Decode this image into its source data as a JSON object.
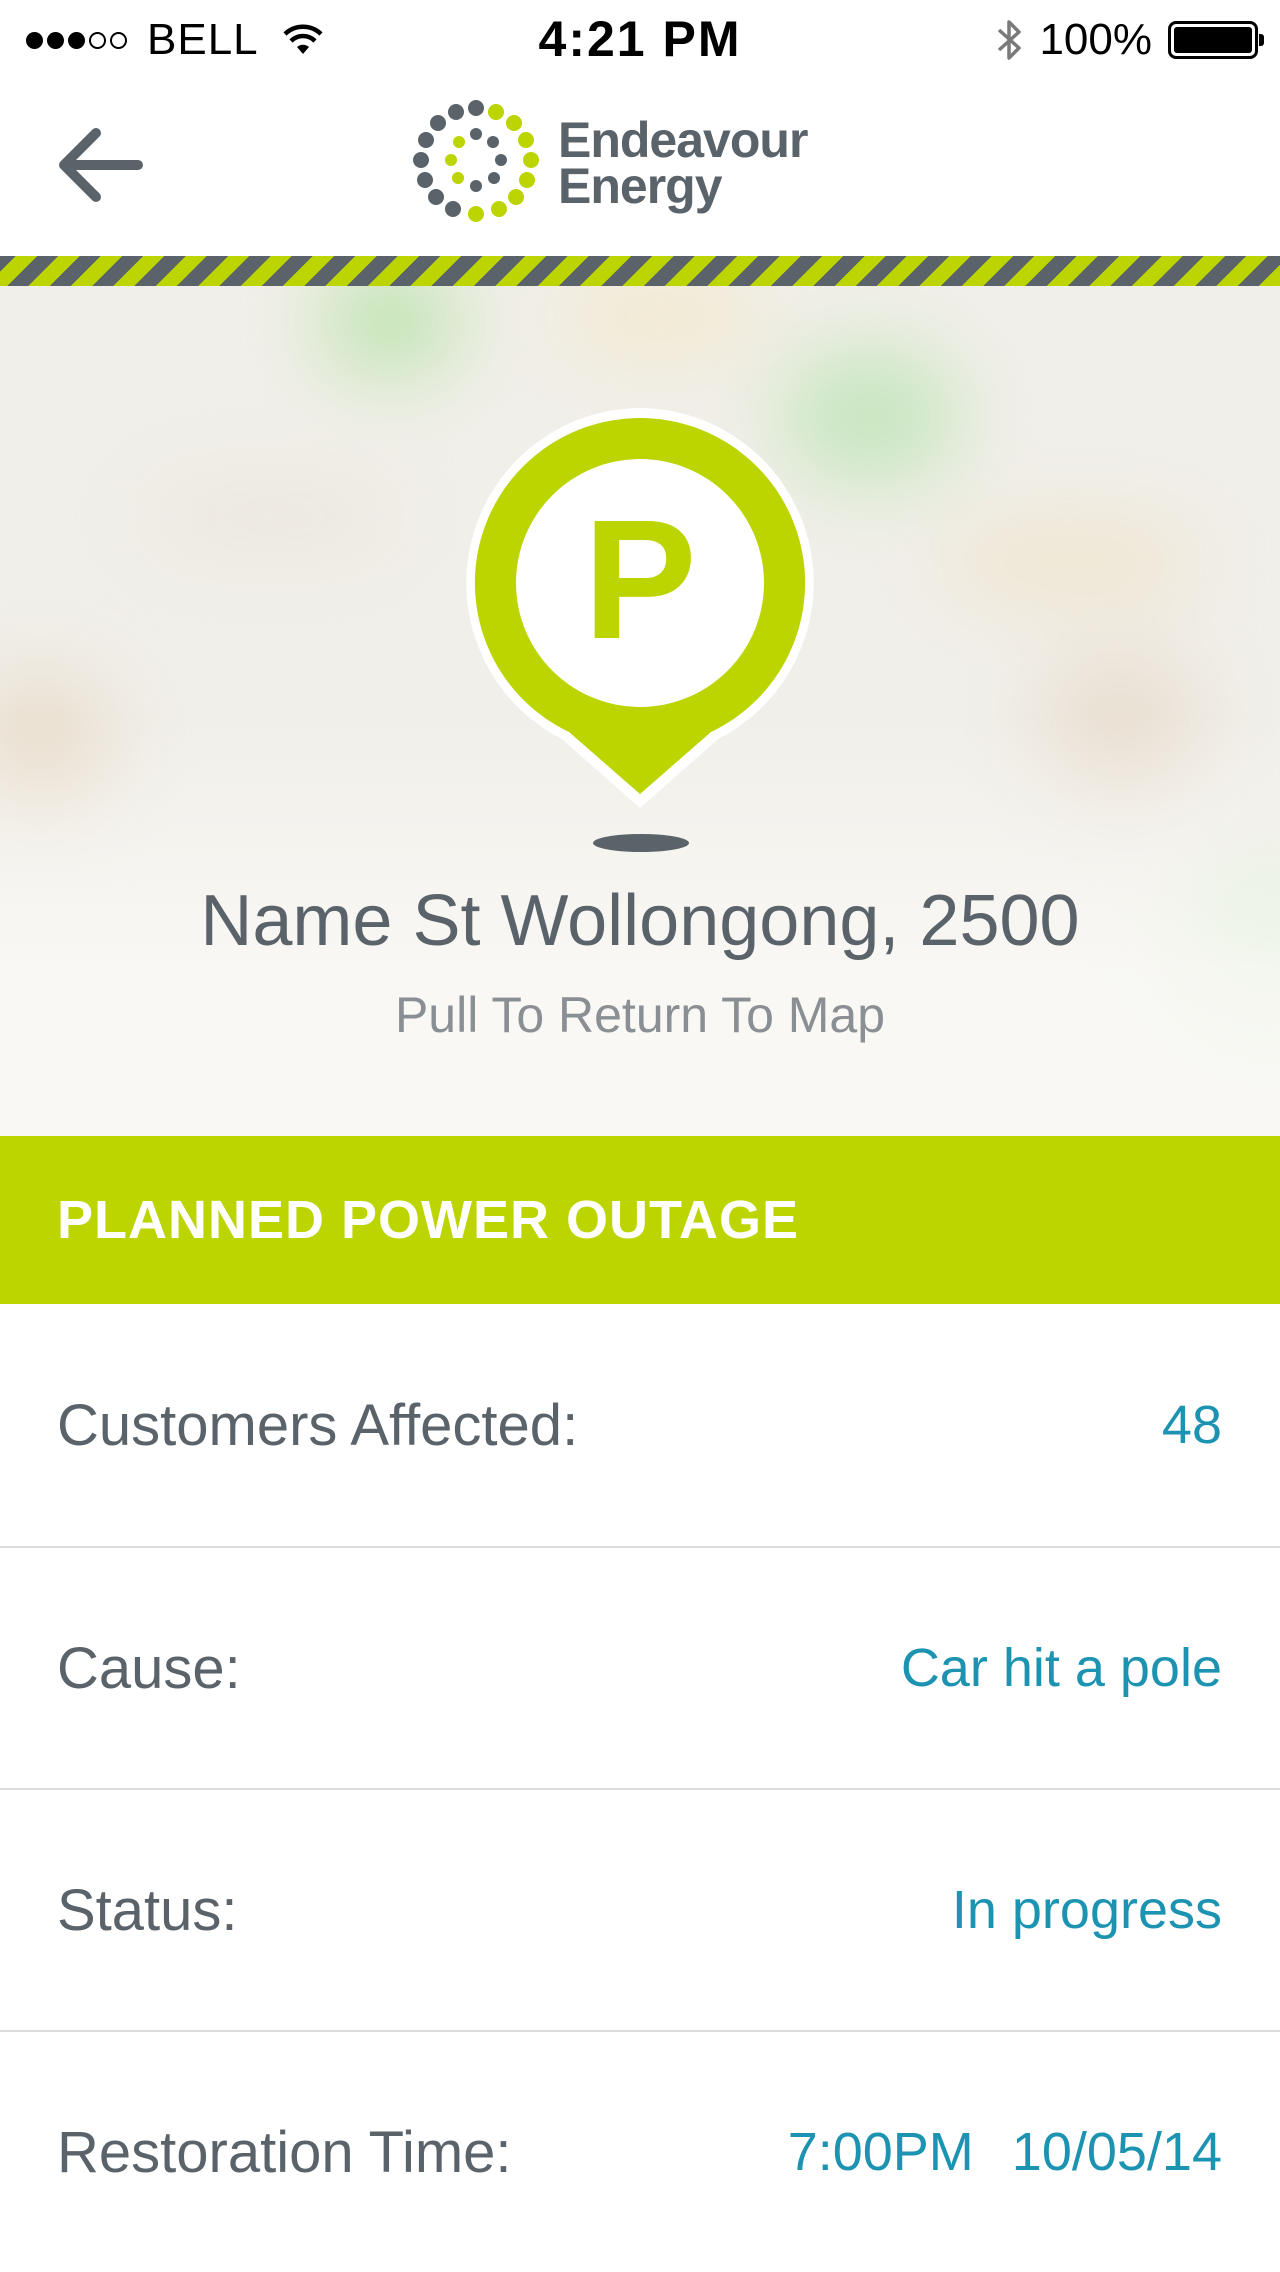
{
  "status_bar": {
    "carrier": "BELL",
    "time": "4:21 PM",
    "battery_percent": "100%",
    "signal_bars_filled": 3,
    "signal_bars_total": 5
  },
  "header": {
    "brand_line1": "Endeavour",
    "brand_line2": "Energy"
  },
  "hero": {
    "pin_letter": "P",
    "address": "Name St Wollongong, 2500",
    "pull_hint": "Pull To Return To Map"
  },
  "banner": {
    "title": "PLANNED POWER OUTAGE"
  },
  "details": {
    "customers_label": "Customers Affected:",
    "customers_value": "48",
    "cause_label": "Cause:",
    "cause_value": "Car hit a pole",
    "status_label": "Status:",
    "status_value": "In progress",
    "restoration_label": "Restoration Time:",
    "restoration_time": "7:00PM",
    "restoration_date": "10/05/14"
  },
  "colors": {
    "brand_green": "#bcd400",
    "brand_grey": "#5b636a",
    "value_blue": "#1c93b1"
  },
  "icons": {
    "back": "arrow-left-icon",
    "wifi": "wifi-icon",
    "bluetooth": "bluetooth-icon",
    "battery": "battery-icon",
    "pin": "map-pin-icon"
  }
}
